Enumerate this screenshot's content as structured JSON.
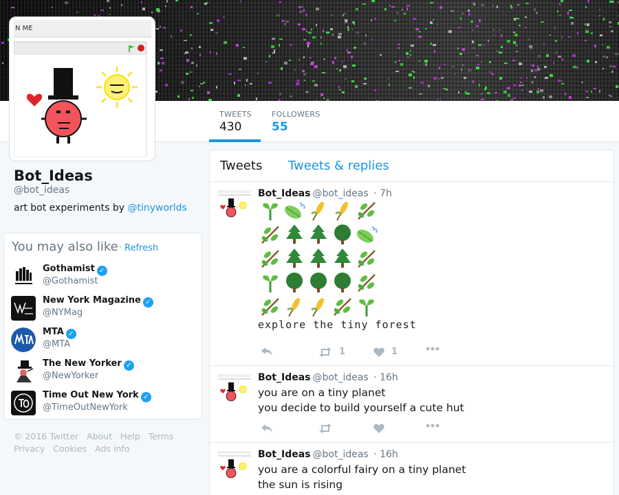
{
  "banner": {
    "description_icon": "glitch-banner"
  },
  "avatar": {
    "window_title": "N ME",
    "icons": [
      "heart-icon",
      "top-hat-character-icon",
      "sun-icon"
    ]
  },
  "nav": {
    "tweets_label": "TWEETS",
    "tweets_count": "430",
    "followers_label": "FOLLOWERS",
    "followers_count": "55"
  },
  "profile": {
    "name": "Bot_Ideas",
    "handle": "@bot_ideas",
    "bio_prefix": "art bot experiments by ",
    "bio_link": "@tinyworlds"
  },
  "wtf": {
    "title": "You may also like",
    "dot": "·",
    "refresh": "Refresh",
    "accounts": [
      {
        "name": "Gothamist",
        "handle": "@Gothamist",
        "icon": "gothamist-logo"
      },
      {
        "name": "New York Magazine",
        "handle": "@NYMag",
        "icon": "nymag-logo"
      },
      {
        "name": "MTA",
        "handle": "@MTA",
        "icon": "mta-logo"
      },
      {
        "name": "The New Yorker",
        "handle": "@NewYorker",
        "icon": "newyorker-logo"
      },
      {
        "name": "Time Out New York",
        "handle": "@TimeOutNewYork",
        "icon": "timeout-logo"
      }
    ],
    "verified_glyph": "✓"
  },
  "footer": {
    "links": [
      "© 2016 Twitter",
      "About",
      "Help",
      "Terms",
      "Privacy",
      "Cookies",
      "Ads info"
    ]
  },
  "timeline": {
    "tab_active": "Tweets",
    "tab_other": "Tweets & replies",
    "tweets": [
      {
        "name": "Bot_Ideas",
        "handle": "@bot_ideas",
        "time": "· 7h",
        "forest_rows": [
          [
            "seedling",
            "leaf",
            "corn",
            "corn",
            "branch"
          ],
          [
            "branch",
            "tree",
            "tree",
            "round-tree",
            "leaf"
          ],
          [
            "branch",
            "tree",
            "tree",
            "tree",
            "branch"
          ],
          [
            "seedling",
            "round-tree",
            "round-tree",
            "round-tree",
            "branch"
          ],
          [
            "branch",
            "corn",
            "corn",
            "branch",
            "seedling"
          ]
        ],
        "caption": "explore the tiny forest",
        "retweets": "1",
        "likes": "1"
      },
      {
        "name": "Bot_Ideas",
        "handle": "@bot_ideas",
        "time": "· 16h",
        "line1": "you are on a tiny planet",
        "line2": "you decide to build yourself a cute hut"
      },
      {
        "name": "Bot_Ideas",
        "handle": "@bot_ideas",
        "time": "· 16h",
        "line1": "you are a colorful fairy on a tiny planet",
        "line2": "the sun is rising"
      }
    ]
  },
  "colors": {
    "accent": "#1b95e0",
    "muted": "#657786",
    "verified": "#1da1f2"
  }
}
